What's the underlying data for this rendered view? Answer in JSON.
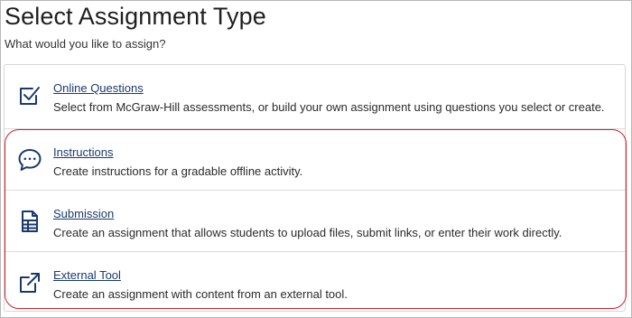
{
  "page": {
    "title": "Select Assignment Type",
    "subtitle": "What would you like to assign?"
  },
  "options": [
    {
      "title": "Online Questions",
      "description": "Select from McGraw-Hill assessments, or build your own assignment using questions you select or create.",
      "icon": "checkbox-icon"
    },
    {
      "title": "Instructions",
      "description": "Create instructions for a gradable offline activity.",
      "icon": "speech-bubble-icon"
    },
    {
      "title": "Submission",
      "description": "Create an assignment that allows students to upload files, submit links, or enter their work directly.",
      "icon": "document-icon"
    },
    {
      "title": "External Tool",
      "description": "Create an assignment with content from an external tool.",
      "icon": "external-link-icon"
    }
  ],
  "colors": {
    "icon": "#1a3a6e",
    "link": "#1a3a6e",
    "highlight": "#d0202f"
  }
}
